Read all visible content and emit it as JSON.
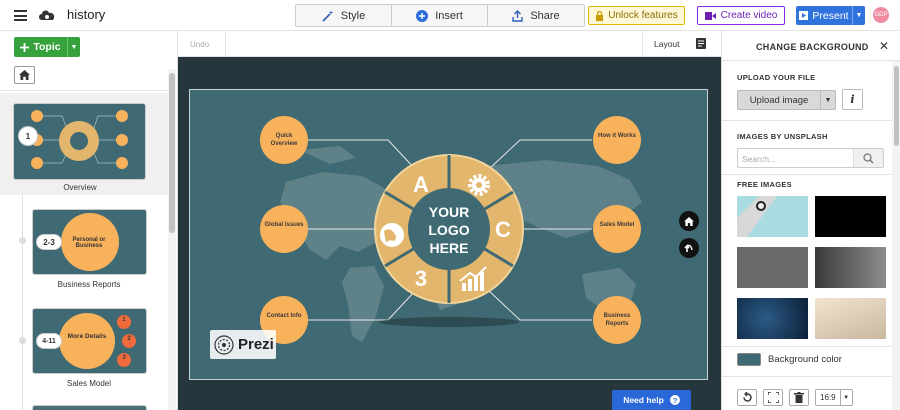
{
  "app": {
    "title": "history"
  },
  "toolbar": {
    "style_label": "Style",
    "insert_label": "Insert",
    "share_label": "Share",
    "unlock_label": "Unlock features",
    "create_video_label": "Create video",
    "present_label": "Present",
    "avatar_initials": "GDP"
  },
  "left_panel": {
    "topic_button": "Topic",
    "items": [
      {
        "number": "1",
        "caption": "Overview"
      },
      {
        "number": "2-3",
        "thumb_title": "Personal or Business",
        "caption": "Business Reports"
      },
      {
        "number": "4-11",
        "thumb_title": "More Details",
        "sub_numbers": [
          "1",
          "2",
          "3"
        ],
        "caption": "Sales Model"
      }
    ]
  },
  "editor": {
    "undo_label": "Undo",
    "layout_label": "Layout",
    "need_help_label": "Need help"
  },
  "slide": {
    "center_text": [
      "YOUR",
      "LOGO",
      "HERE"
    ],
    "segment_labels": {
      "a": "A",
      "c": "C",
      "three": "3"
    },
    "topics": [
      {
        "text": "Quick Overview"
      },
      {
        "text": "Global Issues"
      },
      {
        "text": "Contact Info"
      },
      {
        "text": "How it Works"
      },
      {
        "text": "Sales Model"
      },
      {
        "text": "Business Reports"
      }
    ],
    "watermark": "Prezi",
    "colors": {
      "background": "#3f6a73",
      "circles": "#f9b25c",
      "wheel": "#e2b66c"
    }
  },
  "right_panel": {
    "title": "CHANGE BACKGROUND",
    "upload_section": "UPLOAD YOUR FILE",
    "upload_button": "Upload image",
    "info_icon_text": "i",
    "unsplash_section": "IMAGES BY UNSPLASH",
    "search_placeholder": "Search...",
    "free_section": "FREE IMAGES",
    "background_color_label": "Background color",
    "background_color": "#3f6a73",
    "aspect_ratio": "16:9"
  }
}
